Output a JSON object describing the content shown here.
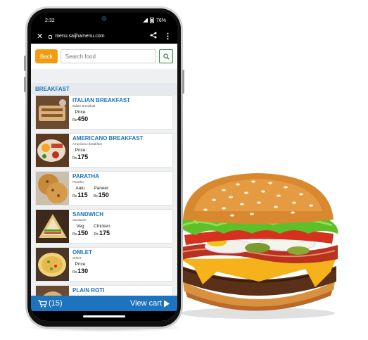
{
  "status_bar": {
    "time": "2:32",
    "battery": "76%"
  },
  "browser": {
    "url": "menu.saijhamenu.com"
  },
  "toolbar": {
    "back_label": "Back",
    "search_placeholder": "Search food"
  },
  "section": {
    "title": "BREAKFAST"
  },
  "items": [
    {
      "name": "ITALIAN BREAKFAST",
      "sub": "Italian Breakfast",
      "prices": [
        {
          "label": "Price",
          "currency": "Rs",
          "value": "450"
        }
      ]
    },
    {
      "name": "AMERICANO BREAKFAST",
      "sub": "Americano Breakfast",
      "prices": [
        {
          "label": "Price",
          "currency": "Rs",
          "value": "175"
        }
      ]
    },
    {
      "name": "PARATHA",
      "sub": "Paratha",
      "prices": [
        {
          "label": "Aalu",
          "currency": "Rs",
          "value": "115"
        },
        {
          "label": "Paneer",
          "currency": "Rs",
          "value": "150"
        }
      ]
    },
    {
      "name": "SANDWICH",
      "sub": "Sandwich",
      "prices": [
        {
          "label": "Veg",
          "currency": "Rs",
          "value": "150"
        },
        {
          "label": "Chicken",
          "currency": "Rs",
          "value": "175"
        }
      ]
    },
    {
      "name": "OMLET",
      "sub": "Omlet",
      "prices": [
        {
          "label": "Price",
          "currency": "Rs",
          "value": "130"
        }
      ]
    },
    {
      "name": "PLAIN ROTI",
      "sub": "",
      "prices": []
    }
  ],
  "cart": {
    "count": "(15)",
    "view_label": "View cart"
  },
  "colors": {
    "accent": "#1e73be",
    "back_button": "#f39c12",
    "search_border": "#2a8a4a"
  },
  "icons": {
    "close": "close-icon",
    "share": "share-icon",
    "more": "more-icon",
    "search": "search-icon",
    "cart": "cart-icon",
    "play": "play-icon"
  }
}
